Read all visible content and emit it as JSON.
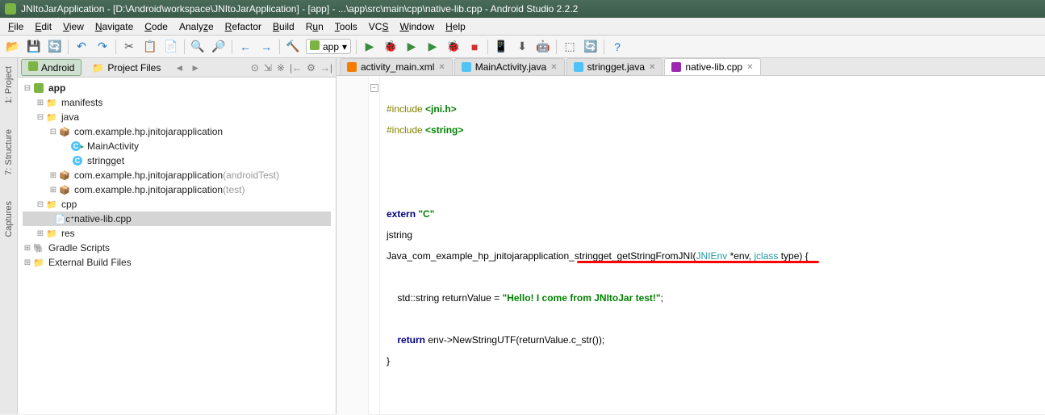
{
  "title": "JNItoJarApplication - [D:\\Android\\workspace\\JNItoJarApplication] - [app] - ...\\app\\src\\main\\cpp\\native-lib.cpp - Android Studio 2.2.2",
  "menu": [
    "File",
    "Edit",
    "View",
    "Navigate",
    "Code",
    "Analyze",
    "Refactor",
    "Build",
    "Run",
    "Tools",
    "VCS",
    "Window",
    "Help"
  ],
  "run_config": "app",
  "panel": {
    "tab_android": "Android",
    "tab_files": "Project Files"
  },
  "side_tabs": {
    "project": "1: Project",
    "structure": "7: Structure",
    "captures": "Captures"
  },
  "tree": [
    {
      "depth": 0,
      "exp": "⊟",
      "icon": "as",
      "label": "app",
      "bold": true
    },
    {
      "depth": 1,
      "exp": "⊞",
      "icon": "folder",
      "label": "manifests"
    },
    {
      "depth": 1,
      "exp": "⊟",
      "icon": "folder",
      "label": "java"
    },
    {
      "depth": 2,
      "exp": "⊟",
      "icon": "pkg",
      "label": "com.example.hp.jnitojarapplication"
    },
    {
      "depth": 3,
      "exp": "",
      "icon": "class",
      "label": "MainActivity",
      "act": true
    },
    {
      "depth": 3,
      "exp": "",
      "icon": "class",
      "label": "stringget"
    },
    {
      "depth": 2,
      "exp": "⊞",
      "icon": "pkg",
      "label": "com.example.hp.jnitojarapplication",
      "suffix": " (androidTest)"
    },
    {
      "depth": 2,
      "exp": "⊞",
      "icon": "pkg",
      "label": "com.example.hp.jnitojarapplication",
      "suffix": " (test)"
    },
    {
      "depth": 1,
      "exp": "⊟",
      "icon": "folder",
      "label": "cpp"
    },
    {
      "depth": 2,
      "exp": "",
      "icon": "file",
      "label": "native-lib.cpp",
      "selected": true
    },
    {
      "depth": 1,
      "exp": "⊞",
      "icon": "folder",
      "label": "res"
    },
    {
      "depth": 0,
      "exp": "⊞",
      "icon": "gradle",
      "label": "Gradle Scripts"
    },
    {
      "depth": 0,
      "exp": "⊞",
      "icon": "folder",
      "label": "External Build Files"
    }
  ],
  "tabs": [
    {
      "icon": "#f57c00",
      "label": "activity_main.xml",
      "active": false
    },
    {
      "icon": "#4fc3f7",
      "label": "MainActivity.java",
      "active": false
    },
    {
      "icon": "#4fc3f7",
      "label": "stringget.java",
      "active": false
    },
    {
      "icon": "#9c27b0",
      "label": "native-lib.cpp",
      "active": true
    }
  ],
  "code": {
    "l1a": "#include ",
    "l1b": "<jni.h>",
    "l2a": "#include ",
    "l2b": "<string>",
    "l5a": "extern ",
    "l5b": "\"C\"",
    "l6": "jstring",
    "l7a": "Java_com_example_hp_jnitojarapplication_stringget_getStringFromJNI(",
    "l7b": "JNIEnv ",
    "l7c": "*env, ",
    "l7d": "jclass ",
    "l7e": "type) {",
    "l9a": "    std::string returnValue = ",
    "l9b": "\"Hello! I come from JNItoJar test!\"",
    "l9c": ";",
    "l11a": "    ",
    "l11b": "return ",
    "l11c": "env->NewStringUTF(returnValue.c_str());",
    "l12": "}"
  }
}
